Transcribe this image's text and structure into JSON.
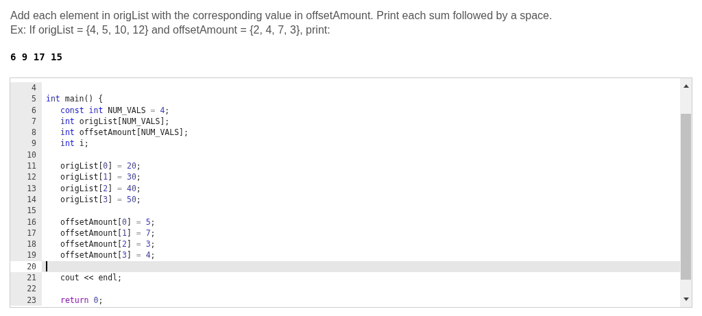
{
  "prompt": {
    "lines": [
      "Add each element in origList with the corresponding value in offsetAmount. Print each sum followed by a space.",
      "Ex: If origList = {4, 5, 10, 12} and offsetAmount = {2, 4, 7, 3}, print:"
    ]
  },
  "sample_output": "6 9 17 15",
  "editor": {
    "lines": [
      {
        "number": "4",
        "active": false
      },
      {
        "number": "5",
        "active": false,
        "tokens": [
          {
            "kind": "kw",
            "text": "int"
          },
          {
            "kind": "plain",
            "text": " main() {"
          }
        ],
        "children": [
          {
            "number": "6",
            "active": false,
            "tokens": [
              {
                "kind": "kw",
                "text": "const int"
              },
              {
                "kind": "plain",
                "text": " NUM_VALS "
              },
              {
                "kind": "op",
                "text": "="
              },
              {
                "kind": "num",
                "text": " 4"
              },
              {
                "kind": "plain",
                "text": ";"
              }
            ]
          },
          {
            "number": "7",
            "active": false,
            "tokens": [
              {
                "kind": "kw",
                "text": "int"
              },
              {
                "kind": "plain",
                "text": " origList[NUM_VALS];"
              }
            ]
          },
          {
            "number": "8",
            "active": false,
            "tokens": [
              {
                "kind": "kw",
                "text": "int"
              },
              {
                "kind": "plain",
                "text": " offsetAmount[NUM_VALS];"
              }
            ]
          },
          {
            "number": "9",
            "active": false,
            "tokens": [
              {
                "kind": "kw",
                "text": "int"
              },
              {
                "kind": "plain",
                "text": " i;"
              }
            ]
          },
          {
            "number": "10",
            "active": false
          },
          {
            "number": "11",
            "active": false,
            "tokens": [
              {
                "kind": "plain",
                "text": "origList["
              },
              {
                "kind": "num",
                "text": "0"
              },
              {
                "kind": "plain",
                "text": "] "
              },
              {
                "kind": "op",
                "text": "="
              },
              {
                "kind": "num",
                "text": " 20"
              },
              {
                "kind": "plain",
                "text": ";"
              }
            ]
          },
          {
            "number": "12",
            "active": false,
            "tokens": [
              {
                "kind": "plain",
                "text": "origList["
              },
              {
                "kind": "num",
                "text": "1"
              },
              {
                "kind": "plain",
                "text": "] "
              },
              {
                "kind": "op",
                "text": "="
              },
              {
                "kind": "num",
                "text": " 30"
              },
              {
                "kind": "plain",
                "text": ";"
              }
            ]
          },
          {
            "number": "13",
            "active": false,
            "tokens": [
              {
                "kind": "plain",
                "text": "origList["
              },
              {
                "kind": "num",
                "text": "2"
              },
              {
                "kind": "plain",
                "text": "] "
              },
              {
                "kind": "op",
                "text": "="
              },
              {
                "kind": "num",
                "text": " 40"
              },
              {
                "kind": "plain",
                "text": ";"
              }
            ]
          },
          {
            "number": "14",
            "active": false,
            "tokens": [
              {
                "kind": "plain",
                "text": "origList["
              },
              {
                "kind": "num",
                "text": "3"
              },
              {
                "kind": "plain",
                "text": "] "
              },
              {
                "kind": "op",
                "text": "="
              },
              {
                "kind": "num",
                "text": " 50"
              },
              {
                "kind": "plain",
                "text": ";"
              }
            ]
          },
          {
            "number": "15",
            "active": false
          },
          {
            "number": "16",
            "active": false,
            "tokens": [
              {
                "kind": "plain",
                "text": "offsetAmount["
              },
              {
                "kind": "num",
                "text": "0"
              },
              {
                "kind": "plain",
                "text": "] "
              },
              {
                "kind": "op",
                "text": "="
              },
              {
                "kind": "num",
                "text": " 5"
              },
              {
                "kind": "plain",
                "text": ";"
              }
            ]
          },
          {
            "number": "17",
            "active": false,
            "tokens": [
              {
                "kind": "plain",
                "text": "offsetAmount["
              },
              {
                "kind": "num",
                "text": "1"
              },
              {
                "kind": "plain",
                "text": "] "
              },
              {
                "kind": "op",
                "text": "="
              },
              {
                "kind": "num",
                "text": " 7"
              },
              {
                "kind": "plain",
                "text": ";"
              }
            ]
          },
          {
            "number": "18",
            "active": false,
            "tokens": [
              {
                "kind": "plain",
                "text": "offsetAmount["
              },
              {
                "kind": "num",
                "text": "2"
              },
              {
                "kind": "plain",
                "text": "] "
              },
              {
                "kind": "op",
                "text": "="
              },
              {
                "kind": "num",
                "text": " 3"
              },
              {
                "kind": "plain",
                "text": ";"
              }
            ]
          },
          {
            "number": "19",
            "active": false,
            "tokens": [
              {
                "kind": "plain",
                "text": "offsetAmount["
              },
              {
                "kind": "num",
                "text": "3"
              },
              {
                "kind": "plain",
                "text": "] "
              },
              {
                "kind": "op",
                "text": "="
              },
              {
                "kind": "num",
                "text": " 4"
              },
              {
                "kind": "plain",
                "text": ";"
              }
            ]
          },
          {
            "number": "20",
            "active": true
          },
          {
            "number": "21",
            "active": false,
            "tokens": [
              {
                "kind": "plain",
                "text": "cout << endl;"
              }
            ]
          },
          {
            "number": "22",
            "active": false
          },
          {
            "number": "23",
            "active": false,
            "tokens": [
              {
                "kind": "ctrl",
                "text": "return"
              },
              {
                "kind": "num",
                "text": " 0"
              },
              {
                "kind": "plain",
                "text": ";"
              }
            ]
          }
        ]
      }
    ]
  }
}
